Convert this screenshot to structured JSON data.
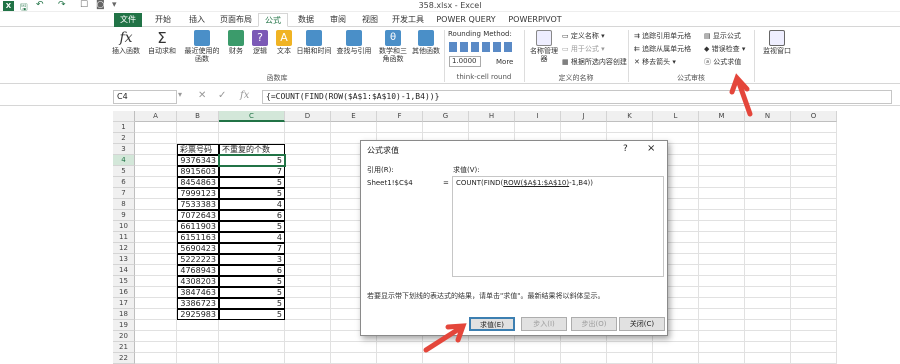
{
  "titlebar": {
    "title": "358.xlsx - Excel"
  },
  "tabs": [
    {
      "label": "文件"
    },
    {
      "label": "开始"
    },
    {
      "label": "插入"
    },
    {
      "label": "页面布局"
    },
    {
      "label": "公式"
    },
    {
      "label": "数据"
    },
    {
      "label": "审阅"
    },
    {
      "label": "视图"
    },
    {
      "label": "开发工具"
    },
    {
      "label": "POWER QUERY"
    },
    {
      "label": "POWERPIVOT"
    }
  ],
  "ribbon": {
    "function_library": {
      "buttons": [
        {
          "label": "插入函数"
        },
        {
          "label": "自动求和"
        },
        {
          "label": "最近使用的函数"
        },
        {
          "label": "财务"
        },
        {
          "label": "逻辑"
        },
        {
          "label": "文本"
        },
        {
          "label": "日期和时间"
        },
        {
          "label": "查找与引用"
        },
        {
          "label": "数学和三角函数"
        },
        {
          "label": "其他函数"
        }
      ],
      "group_label": "函数库"
    },
    "rounding": {
      "title": "Rounding Method:",
      "value": "1.0000",
      "more": "More",
      "group_label": "think-cell round"
    },
    "defined_names": {
      "manager": "名称管理器",
      "define_name": "定义名称",
      "use_in_formula": "用于公式",
      "create_from_selection": "根据所选内容创建",
      "group_label": "定义的名称"
    },
    "formula_auditing": {
      "trace_precedents": "追踪引用单元格",
      "trace_dependents": "追踪从属单元格",
      "remove_arrows": "移去箭头",
      "show_formulas": "显示公式",
      "error_checking": "错误检查",
      "evaluate_formula": "公式求值",
      "group_label": "公式审核"
    },
    "watch_window": "监视窗口"
  },
  "formula_bar": {
    "name_box": "C4",
    "formula": "{=COUNT(FIND(ROW($A$1:$A$10)-1,B4))}"
  },
  "sheet": {
    "columns": [
      "A",
      "B",
      "C",
      "D",
      "E",
      "F",
      "G",
      "H",
      "I",
      "J",
      "K",
      "L",
      "M",
      "N",
      "O"
    ],
    "rows": [
      "1",
      "2",
      "3",
      "4",
      "5",
      "6",
      "7",
      "8",
      "9",
      "10",
      "11",
      "12",
      "13",
      "14",
      "15",
      "16",
      "17",
      "18",
      "19",
      "20",
      "21",
      "22"
    ],
    "headers": {
      "b": "彩票号码",
      "c": "不重复的个数"
    },
    "data": [
      {
        "b": "9376343",
        "c": "5"
      },
      {
        "b": "8915603",
        "c": "7"
      },
      {
        "b": "8454863",
        "c": "5"
      },
      {
        "b": "7999123",
        "c": "5"
      },
      {
        "b": "7533383",
        "c": "4"
      },
      {
        "b": "7072643",
        "c": "6"
      },
      {
        "b": "6611903",
        "c": "5"
      },
      {
        "b": "6151163",
        "c": "4"
      },
      {
        "b": "5690423",
        "c": "7"
      },
      {
        "b": "5222223",
        "c": "3"
      },
      {
        "b": "4768943",
        "c": "6"
      },
      {
        "b": "4308203",
        "c": "5"
      },
      {
        "b": "3847463",
        "c": "5"
      },
      {
        "b": "3386723",
        "c": "5"
      },
      {
        "b": "2925983",
        "c": "5"
      }
    ]
  },
  "dialog": {
    "title": "公式求值",
    "help": "?",
    "close": "×",
    "reference_label": "引用(R):",
    "reference_value": "Sheet1!$C$4",
    "equals": "=",
    "evaluation_label": "求值(V):",
    "eval_prefix": "COUNT(FIND(",
    "eval_underlined": "ROW($A$1:$A$10)",
    "eval_suffix": "-1,B4))",
    "note": "若要显示带下划线的表达式的结果，请单击\"求值\"。最新结果将以斜体显示。",
    "buttons": {
      "evaluate": "求值(E)",
      "step_in": "步入(I)",
      "step_out": "步出(O)",
      "close": "关闭(C)"
    }
  },
  "colors": {
    "accent": "#217346",
    "arrow": "#e4463b"
  }
}
